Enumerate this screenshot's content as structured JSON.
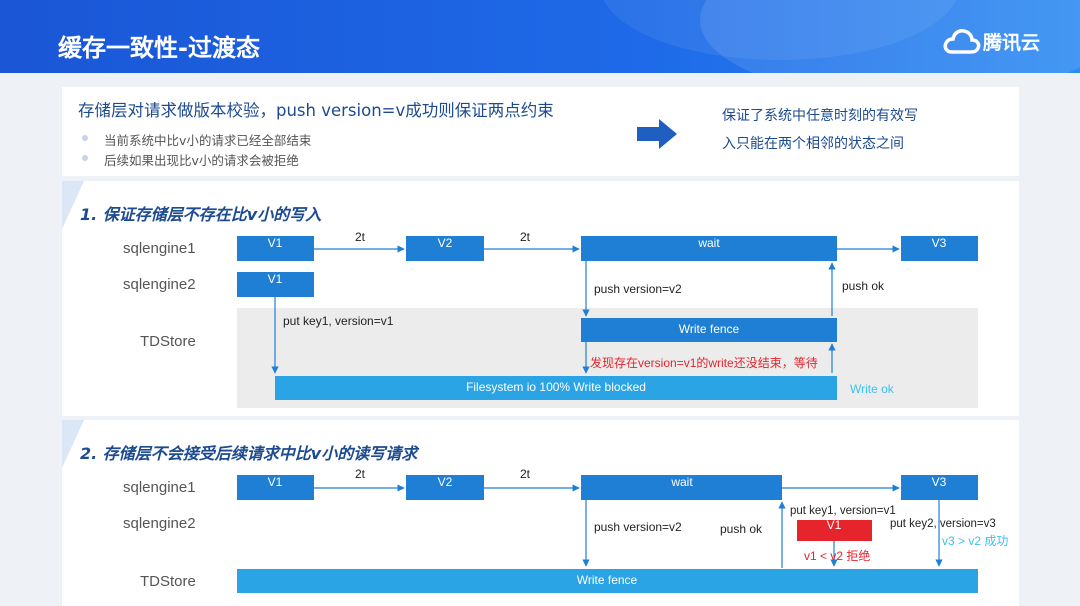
{
  "header": {
    "title": "缓存一致性-过渡态",
    "logo_text": "腾讯云"
  },
  "intro": {
    "title": "存储层对请求做版本校验，push version=v成功则保证两点约束",
    "bullets": [
      "当前系统中比v小的请求已经全部结束",
      "后续如果出现比v小的请求会被拒绝"
    ],
    "conclusion_line1": "保证了系统中任意时刻的有效写",
    "conclusion_line2": "入只能在两个相邻的状态之间"
  },
  "section1": {
    "title": "1. 保证存储层不存在比v小的写入",
    "rows": [
      "sqlengine1",
      "sqlengine2",
      "TDStore"
    ],
    "boxes": {
      "v1": "V1",
      "v2": "V2",
      "wait": "wait",
      "v3": "V3",
      "v1b": "V1",
      "fence": "Write fence",
      "fs": "Filesystem io 100% Write blocked"
    },
    "labels": {
      "t1": "2t",
      "t2": "2t",
      "push": "push version=v2",
      "pushok": "push ok",
      "put": "put key1, version=v1",
      "warn": "发现存在version=v1的write还没结束，等待",
      "writeok": "Write ok"
    }
  },
  "section2": {
    "title": "2. 存储层不会接受后续请求中比v小的读写请求",
    "rows": [
      "sqlengine1",
      "sqlengine2",
      "TDStore"
    ],
    "boxes": {
      "v1": "V1",
      "v2": "V2",
      "wait": "wait",
      "v3": "V3",
      "v1b": "V1",
      "fence": "Write fence"
    },
    "labels": {
      "t1": "2t",
      "t2": "2t",
      "push": "push version=v2",
      "pushok": "push ok",
      "put1": "put key1, version=v1",
      "put2": "put key2, version=v3",
      "reject": "v1 < v2 拒绝",
      "success": "v3 > v2 成功"
    }
  },
  "colors": {
    "box": "#1f7fd4",
    "fs": "#2ba4e6",
    "warn": "#e5242b",
    "ok": "#3cc0f0"
  }
}
